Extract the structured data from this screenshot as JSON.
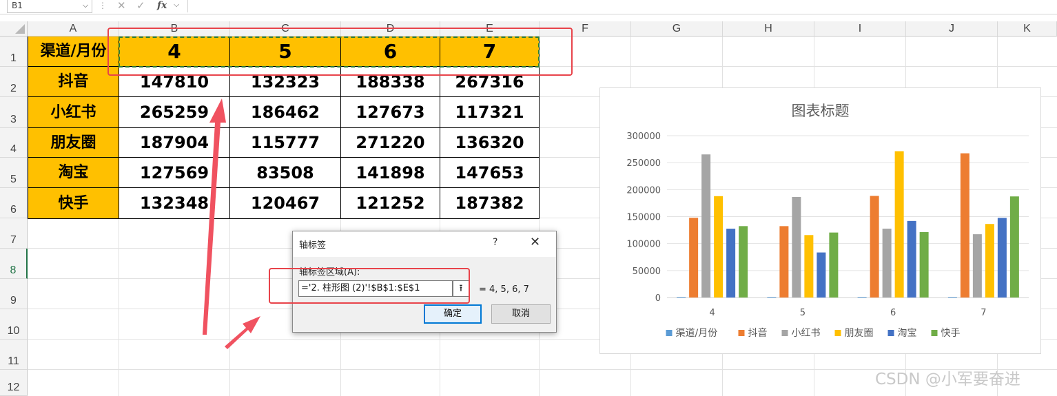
{
  "formula_bar": {
    "name_box": "B1",
    "name_box_dropdown": "⌵",
    "dots": "⋮",
    "cancel_icon": "✕",
    "enter_icon": "✓",
    "fx_label": "fx",
    "fx_dropdown": "⌵",
    "formula": ""
  },
  "columns": [
    "A",
    "B",
    "C",
    "D",
    "E",
    "F",
    "G",
    "H",
    "I",
    "J",
    "K"
  ],
  "rows": [
    "1",
    "2",
    "3",
    "4",
    "5",
    "6",
    "7",
    "8",
    "9",
    "10",
    "11",
    "12"
  ],
  "table": {
    "corner": "渠道/月份",
    "months": [
      "4",
      "5",
      "6",
      "7"
    ],
    "channels": [
      {
        "name": "抖音",
        "values": [
          "147810",
          "132323",
          "188338",
          "267316"
        ]
      },
      {
        "name": "小红书",
        "values": [
          "265259",
          "186462",
          "127673",
          "117321"
        ]
      },
      {
        "name": "朋友圈",
        "values": [
          "187904",
          "115777",
          "271220",
          "136320"
        ]
      },
      {
        "name": "淘宝",
        "values": [
          "127569",
          "83508",
          "141898",
          "147653"
        ]
      },
      {
        "name": "快手",
        "values": [
          "132348",
          "120467",
          "121252",
          "187382"
        ]
      }
    ]
  },
  "dialog": {
    "title": "轴标签",
    "help": "?",
    "close": "✕",
    "field_label": "轴标签区域(A):",
    "field_value": "='2. 柱形图 (2)'!$B$1:$E$1",
    "collapse_icon": "⭱",
    "preview": "= 4, 5, 6, 7",
    "ok": "确定",
    "cancel": "取消"
  },
  "chart_data": {
    "type": "bar",
    "title": "图表标题",
    "categories": [
      "4",
      "5",
      "6",
      "7"
    ],
    "ylim": [
      0,
      300000
    ],
    "yticks": [
      "0",
      "50000",
      "100000",
      "150000",
      "200000",
      "250000",
      "300000"
    ],
    "grid": true,
    "legend_position": "bottom",
    "series": [
      {
        "name": "渠道/月份",
        "color": "#5b9bd5",
        "values": [
          4,
          5,
          6,
          7
        ]
      },
      {
        "name": "抖音",
        "color": "#ed7d31",
        "values": [
          147810,
          132323,
          188338,
          267316
        ]
      },
      {
        "name": "小红书",
        "color": "#a5a5a5",
        "values": [
          265259,
          186462,
          127673,
          117321
        ]
      },
      {
        "name": "朋友圈",
        "color": "#ffc000",
        "values": [
          187904,
          115777,
          271220,
          136320
        ]
      },
      {
        "name": "淘宝",
        "color": "#4472c4",
        "values": [
          127569,
          83508,
          141898,
          147653
        ]
      },
      {
        "name": "快手",
        "color": "#70ad47",
        "values": [
          132348,
          120467,
          121252,
          187382
        ]
      }
    ]
  },
  "watermark": "CSDN @小军要奋进",
  "colors": {
    "header_fill": "#ffc000",
    "annotation_red": "#e8434a",
    "marquee_green": "#2e7d32"
  }
}
